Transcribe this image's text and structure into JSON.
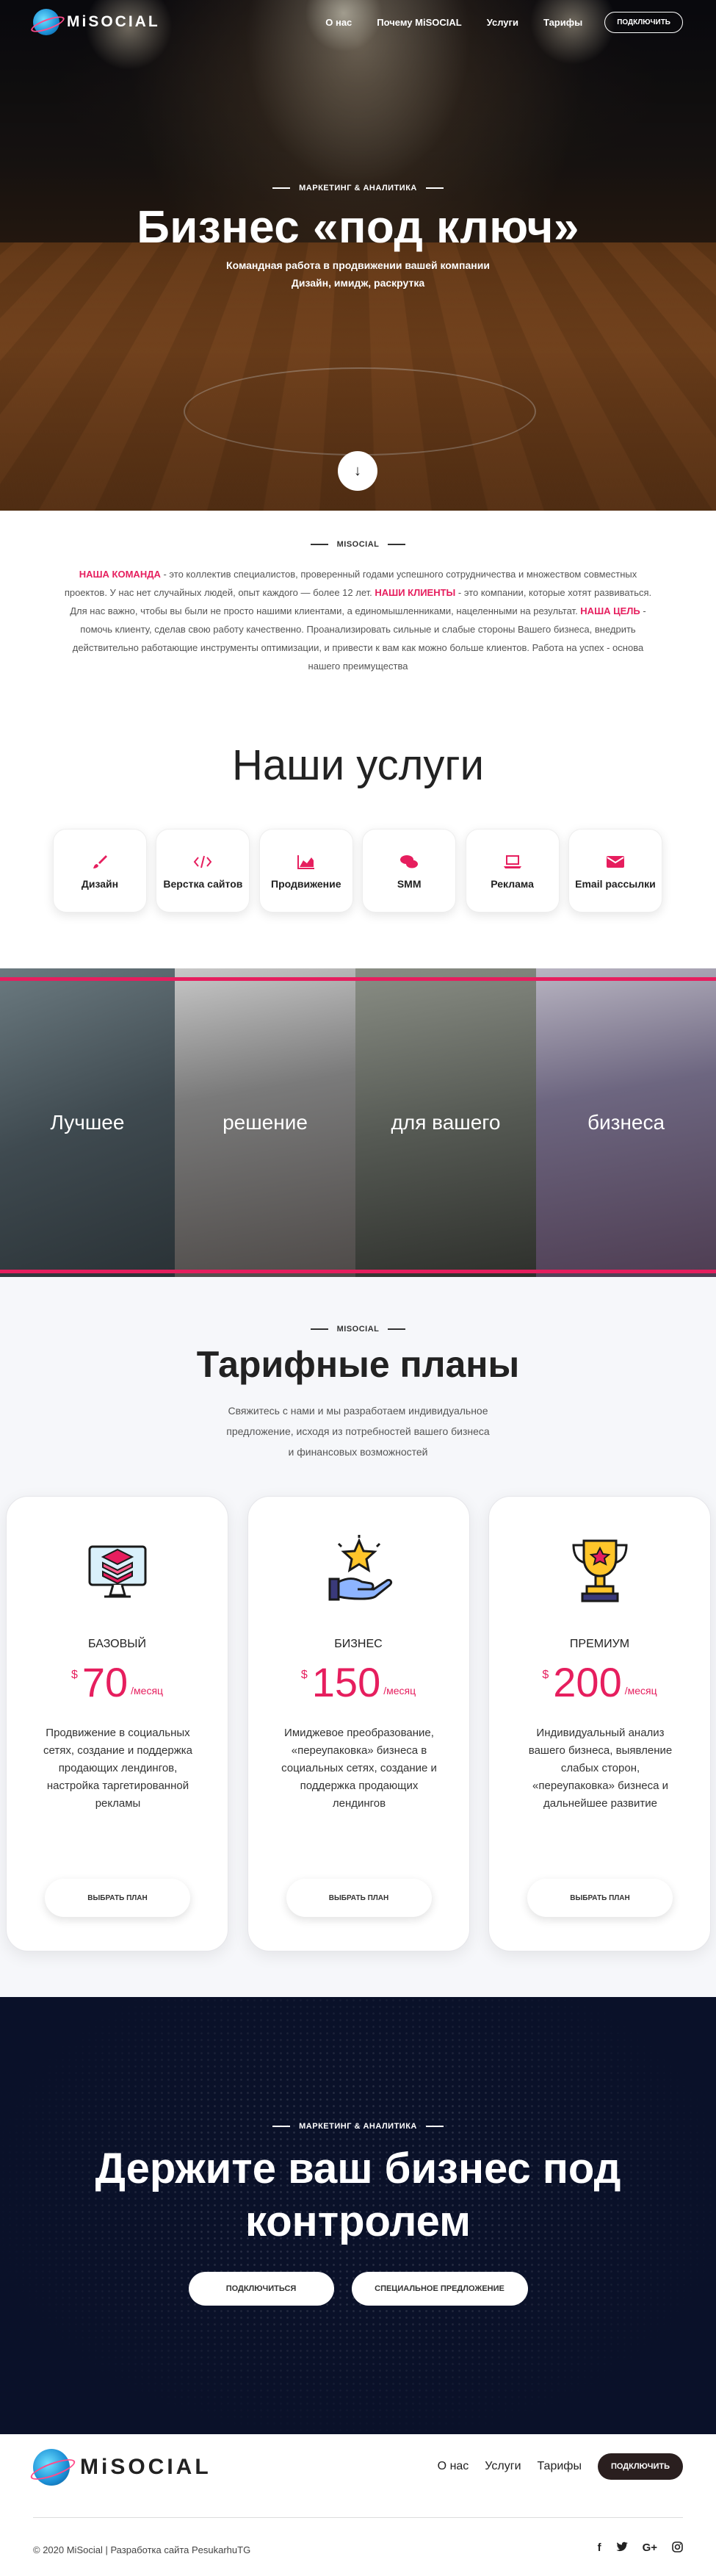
{
  "nav": {
    "logo_text": "MiSOCIAL",
    "links": [
      "О нас",
      "Почему MiSOCIAL",
      "Услуги",
      "Тарифы"
    ],
    "button": "ПОДКЛЮЧИТЬ"
  },
  "hero": {
    "kicker": "МАРКЕТИНГ & АНАЛИТИКА",
    "title": "Бизнес «под ключ»",
    "subtitle": "Командная работа в продвижении вашей компании",
    "subtitle2": "Дизайн, имидж, раскрутка",
    "scroll_icon": "arrow-down-icon"
  },
  "about": {
    "kicker": "MISOCIAL",
    "p1_label": "НАША КОМАНДА",
    "p1_text": " - это коллектив специалистов, проверенный годами успешного сотрудничества и множеством совместных проектов. У нас нет случайных людей, опыт каждого — более 12 лет. ",
    "p2_label": "НАШИ КЛИЕНТЫ",
    "p2_text": " - это компании, которые хотят развиваться. Для нас важно, чтобы вы были не просто нашими клиентами, а единомышленниками, нацеленными на результат. ",
    "p3_label": "НАША ЦЕЛЬ",
    "p3_text": " - помочь клиенту, сделав свою работу качественно. Проанализировать сильные и слабые стороны Вашего бизнеса, внедрить действительно работающие инструменты оптимизации, и привести к вам как можно больше клиентов. Работа на успех - основа нашего преимущества"
  },
  "services": {
    "title": "Наши услуги",
    "items": [
      {
        "label": "Дизайн",
        "icon": "brush-icon"
      },
      {
        "label": "Верстка сайтов",
        "icon": "code-icon"
      },
      {
        "label": "Продвижение",
        "icon": "chart-icon"
      },
      {
        "label": "SMM",
        "icon": "chat-icon"
      },
      {
        "label": "Реклама",
        "icon": "laptop-icon"
      },
      {
        "label": "Email рассылки",
        "icon": "mail-icon"
      }
    ]
  },
  "banner": {
    "words": [
      "Лучшее",
      "решение",
      "для вашего",
      "бизнеса"
    ]
  },
  "pricing": {
    "kicker": "MISOCIAL",
    "title": "Тарифные планы",
    "desc_lines": [
      "Свяжитесь с нами и мы разработаем индивидуальное",
      "предложение, исходя из потребностей вашего бизнеса",
      "и финансовых возможностей"
    ],
    "plans": [
      {
        "name": "БАЗОВЫЙ",
        "currency": "$",
        "price": "70",
        "period": "/месяц",
        "icon": "layers-monitor-icon",
        "desc": "Продвижение в социальных сетях, создание и поддержка продающих лендингов, настройка таргетированной рекламы",
        "button": "ВЫБРАТЬ ПЛАН"
      },
      {
        "name": "БИЗНЕС",
        "currency": "$",
        "price": "150",
        "period": "/месяц",
        "icon": "hand-star-icon",
        "desc": "Имиджевое преобразование, «переупаковка» бизнеса в социальных сетях, создание и поддержка продающих лендингов",
        "button": "ВЫБРАТЬ ПЛАН"
      },
      {
        "name": "ПРЕМИУМ",
        "currency": "$",
        "price": "200",
        "period": "/месяц",
        "icon": "trophy-icon",
        "desc": "Индивидуальный анализ вашего бизнеса, выявление слабых сторон, «переупаковка» бизнеса и дальнейшее развитие",
        "button": "ВЫБРАТЬ ПЛАН"
      }
    ],
    "accent": "#e61e5e"
  },
  "cta": {
    "kicker": "МАРКЕТИНГ & АНАЛИТИКА",
    "title_line1": "Держите ваш бизнес под",
    "title_line2": "контролем",
    "button1": "ПОДКЛЮЧИТЬСЯ",
    "button2": "СПЕЦИАЛЬНОЕ ПРЕДЛОЖЕНИЕ"
  },
  "footer": {
    "logo_text": "MiSOCIAL",
    "links": [
      "О нас",
      "Услуги",
      "Тарифы"
    ],
    "button": "ПОДКЛЮЧИТЬ",
    "copyright": "© 2020 MiSocial | Разработка сайта PesukarhuTG",
    "social": [
      {
        "icon": "facebook-icon",
        "glyph": "f"
      },
      {
        "icon": "twitter-icon",
        "glyph": "🐦"
      },
      {
        "icon": "google-plus-icon",
        "glyph": "G+"
      },
      {
        "icon": "instagram-icon",
        "glyph": "◎"
      }
    ]
  }
}
